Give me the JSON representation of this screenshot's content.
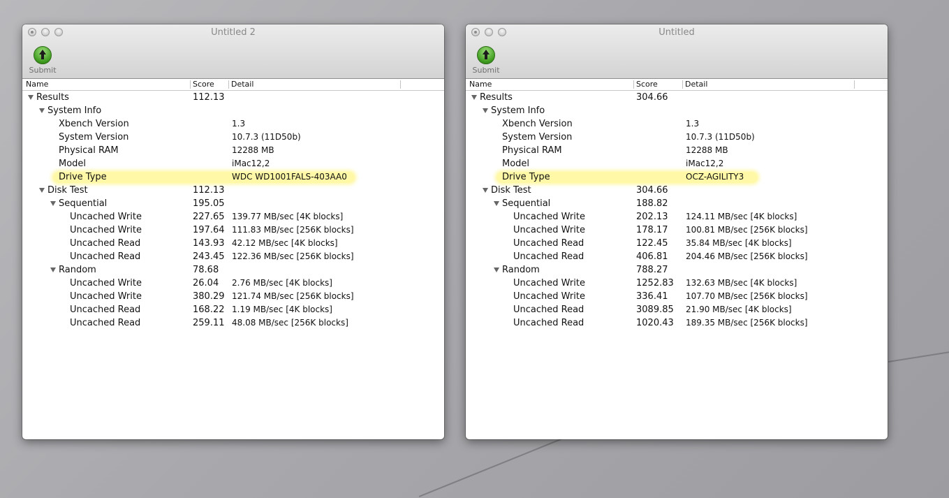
{
  "columns": {
    "name": "Name",
    "score": "Score",
    "detail": "Detail"
  },
  "submit_label": "Submit",
  "windows": [
    {
      "title": "Untitled 2",
      "rows": [
        {
          "name": "Results",
          "score": "112.13",
          "detail": "",
          "level": 0,
          "expandable": true
        },
        {
          "name": "System Info",
          "score": "",
          "detail": "",
          "level": 1,
          "expandable": true
        },
        {
          "name": "Xbench Version",
          "score": "",
          "detail": "1.3",
          "level": 2
        },
        {
          "name": "System Version",
          "score": "",
          "detail": "10.7.3 (11D50b)",
          "level": 2
        },
        {
          "name": "Physical RAM",
          "score": "",
          "detail": "12288 MB",
          "level": 2
        },
        {
          "name": "Model",
          "score": "",
          "detail": "iMac12,2",
          "level": 2
        },
        {
          "name": "Drive Type",
          "score": "",
          "detail": "WDC WD1001FALS-403AA0",
          "level": 2,
          "highlight": true
        },
        {
          "name": "Disk Test",
          "score": "112.13",
          "detail": "",
          "level": 1,
          "expandable": true
        },
        {
          "name": "Sequential",
          "score": "195.05",
          "detail": "",
          "level": 2,
          "expandable": true
        },
        {
          "name": "Uncached Write",
          "score": "227.65",
          "detail": "139.77 MB/sec [4K blocks]",
          "level": 3
        },
        {
          "name": "Uncached Write",
          "score": "197.64",
          "detail": "111.83 MB/sec [256K blocks]",
          "level": 3
        },
        {
          "name": "Uncached Read",
          "score": "143.93",
          "detail": "42.12 MB/sec [4K blocks]",
          "level": 3
        },
        {
          "name": "Uncached Read",
          "score": "243.45",
          "detail": "122.36 MB/sec [256K blocks]",
          "level": 3
        },
        {
          "name": "Random",
          "score": "78.68",
          "detail": "",
          "level": 2,
          "expandable": true
        },
        {
          "name": "Uncached Write",
          "score": "26.04",
          "detail": "2.76 MB/sec [4K blocks]",
          "level": 3
        },
        {
          "name": "Uncached Write",
          "score": "380.29",
          "detail": "121.74 MB/sec [256K blocks]",
          "level": 3
        },
        {
          "name": "Uncached Read",
          "score": "168.22",
          "detail": "1.19 MB/sec [4K blocks]",
          "level": 3
        },
        {
          "name": "Uncached Read",
          "score": "259.11",
          "detail": "48.08 MB/sec [256K blocks]",
          "level": 3
        }
      ]
    },
    {
      "title": "Untitled",
      "rows": [
        {
          "name": "Results",
          "score": "304.66",
          "detail": "",
          "level": 0,
          "expandable": true
        },
        {
          "name": "System Info",
          "score": "",
          "detail": "",
          "level": 1,
          "expandable": true
        },
        {
          "name": "Xbench Version",
          "score": "",
          "detail": "1.3",
          "level": 2
        },
        {
          "name": "System Version",
          "score": "",
          "detail": "10.7.3 (11D50b)",
          "level": 2
        },
        {
          "name": "Physical RAM",
          "score": "",
          "detail": "12288 MB",
          "level": 2
        },
        {
          "name": "Model",
          "score": "",
          "detail": "iMac12,2",
          "level": 2
        },
        {
          "name": "Drive Type",
          "score": "",
          "detail": "OCZ-AGILITY3",
          "level": 2,
          "highlight": true
        },
        {
          "name": "Disk Test",
          "score": "304.66",
          "detail": "",
          "level": 1,
          "expandable": true
        },
        {
          "name": "Sequential",
          "score": "188.82",
          "detail": "",
          "level": 2,
          "expandable": true
        },
        {
          "name": "Uncached Write",
          "score": "202.13",
          "detail": "124.11 MB/sec [4K blocks]",
          "level": 3
        },
        {
          "name": "Uncached Write",
          "score": "178.17",
          "detail": "100.81 MB/sec [256K blocks]",
          "level": 3
        },
        {
          "name": "Uncached Read",
          "score": "122.45",
          "detail": "35.84 MB/sec [4K blocks]",
          "level": 3
        },
        {
          "name": "Uncached Read",
          "score": "406.81",
          "detail": "204.46 MB/sec [256K blocks]",
          "level": 3
        },
        {
          "name": "Random",
          "score": "788.27",
          "detail": "",
          "level": 2,
          "expandable": true
        },
        {
          "name": "Uncached Write",
          "score": "1252.83",
          "detail": "132.63 MB/sec [4K blocks]",
          "level": 3
        },
        {
          "name": "Uncached Write",
          "score": "336.41",
          "detail": "107.70 MB/sec [256K blocks]",
          "level": 3
        },
        {
          "name": "Uncached Read",
          "score": "3089.85",
          "detail": "21.90 MB/sec [4K blocks]",
          "level": 3
        },
        {
          "name": "Uncached Read",
          "score": "1020.43",
          "detail": "189.35 MB/sec [256K blocks]",
          "level": 3
        }
      ]
    }
  ]
}
